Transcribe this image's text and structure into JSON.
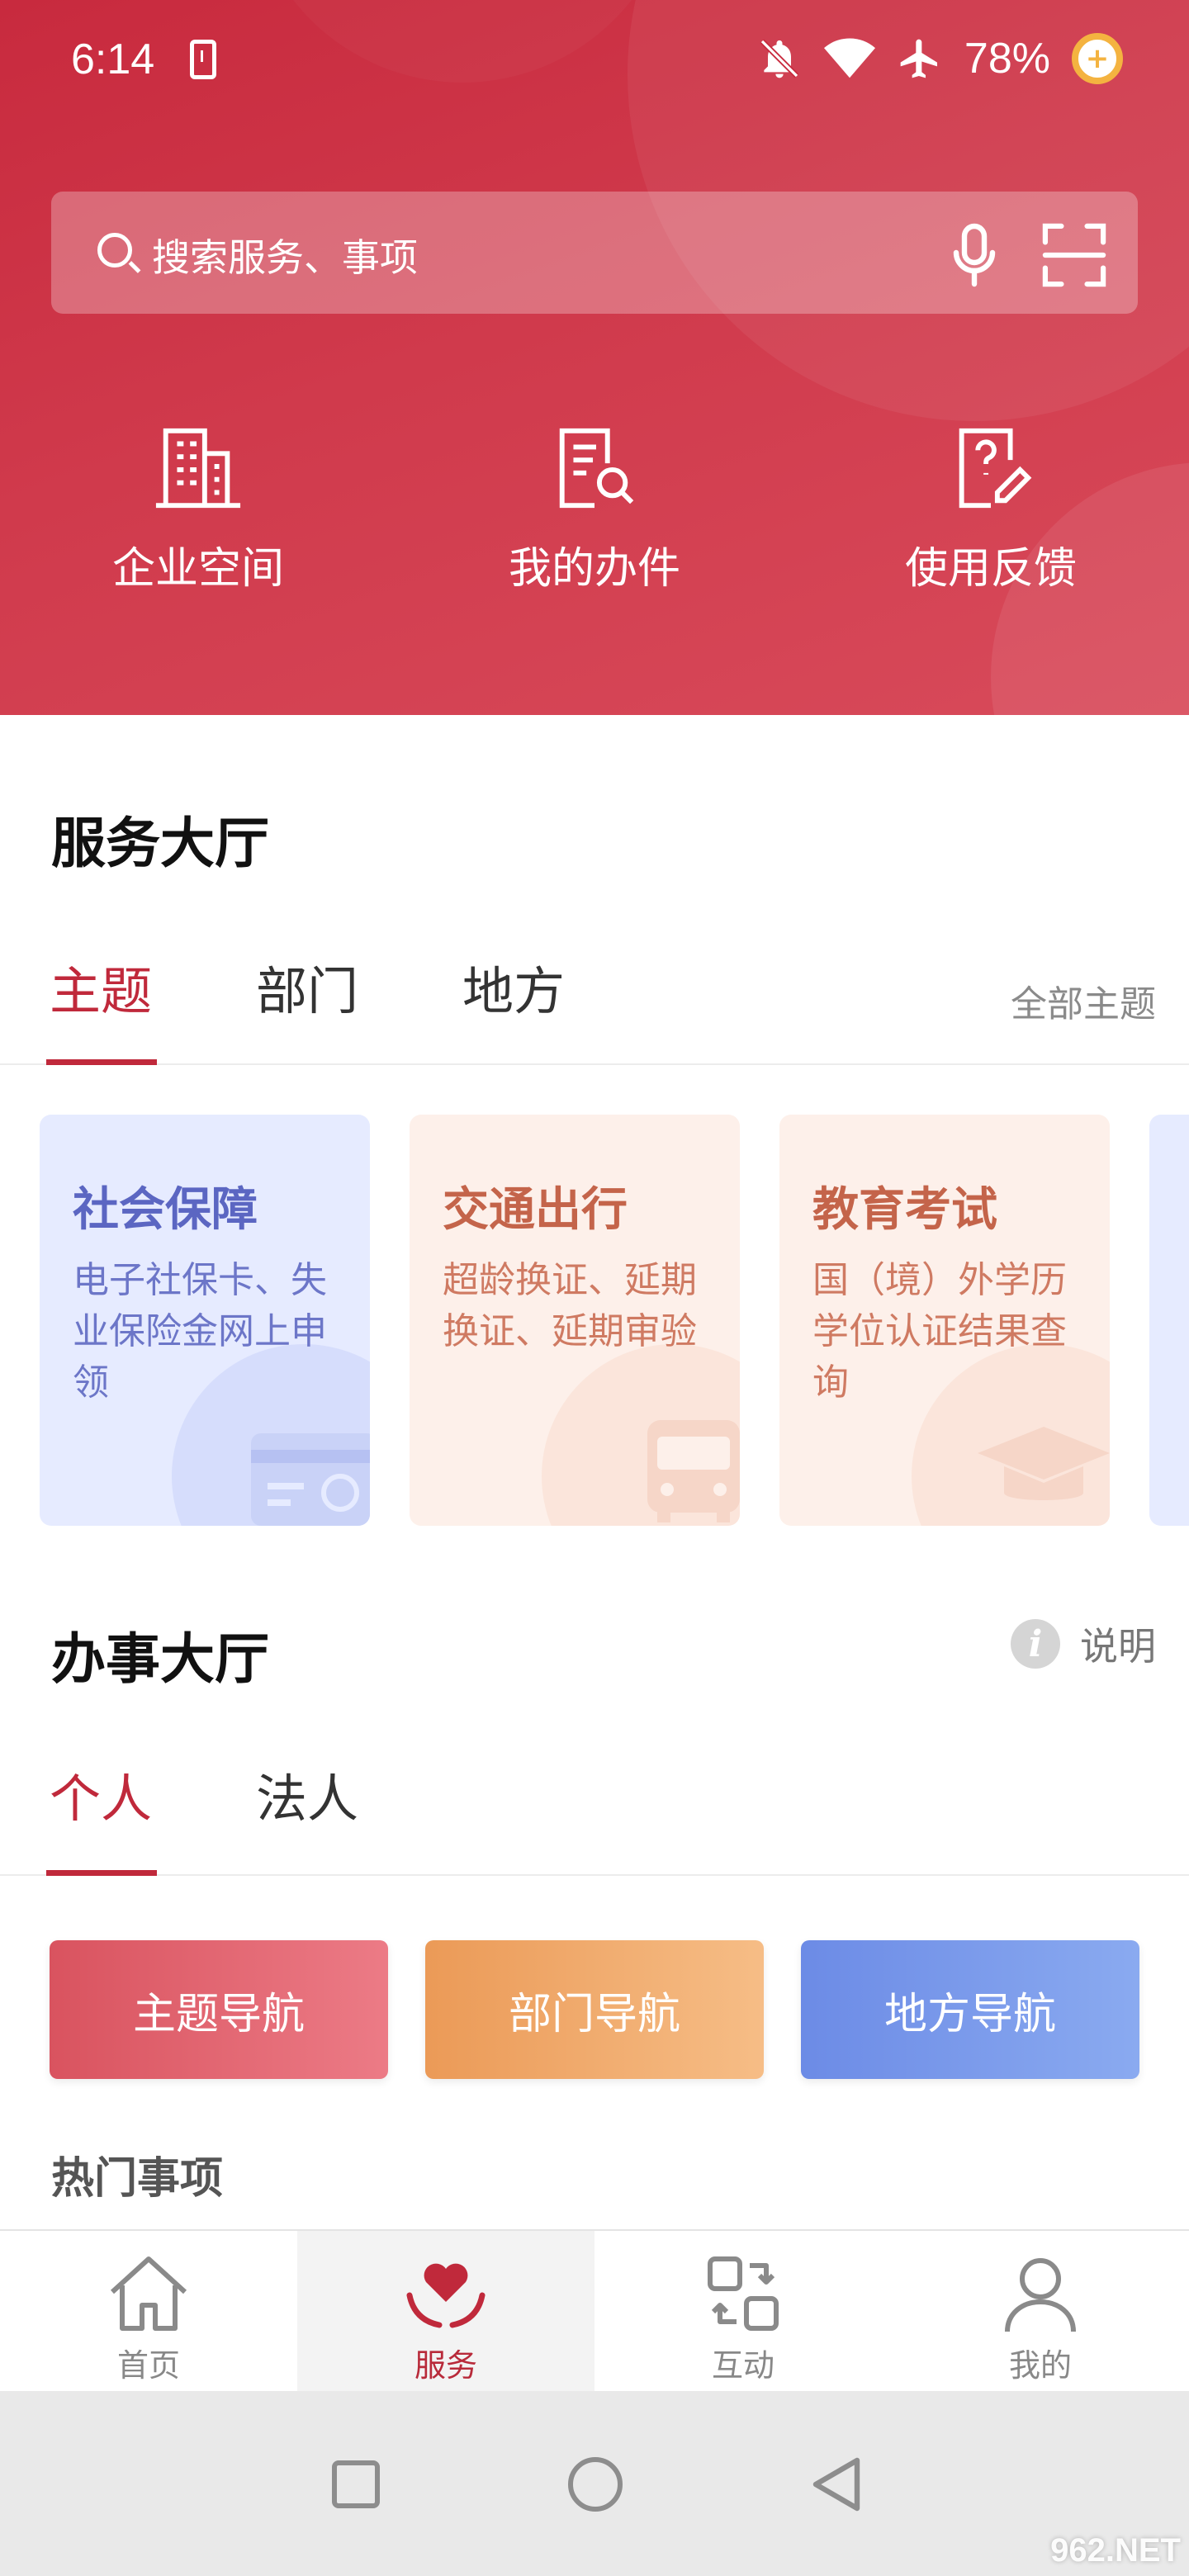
{
  "status": {
    "time": "6:14",
    "battery": "78%"
  },
  "search": {
    "placeholder": "搜索服务、事项"
  },
  "quick_actions": [
    {
      "label": "企业空间",
      "icon": "building-icon"
    },
    {
      "label": "我的办件",
      "icon": "document-search-icon"
    },
    {
      "label": "使用反馈",
      "icon": "feedback-edit-icon"
    }
  ],
  "service_hall": {
    "title": "服务大厅",
    "tabs": [
      "主题",
      "部门",
      "地方"
    ],
    "active_tab": "主题",
    "more": "全部主题",
    "cards": [
      {
        "title": "社会保障",
        "desc": "电子社保卡、失业保险金网上申领",
        "color": "#5b66c2",
        "bg": "#e6ebff"
      },
      {
        "title": "交通出行",
        "desc": "超龄换证、延期换证、延期审验",
        "color": "#c4644a",
        "bg": "#fdf0ea"
      },
      {
        "title": "教育考试",
        "desc": "国（境）外学历学位认证结果查询",
        "color": "#c4644a",
        "bg": "#fdf0ea"
      }
    ]
  },
  "affairs_hall": {
    "title": "办事大厅",
    "help": "说明",
    "tabs": [
      "个人",
      "法人"
    ],
    "active_tab": "个人",
    "nav_buttons": [
      {
        "label": "主题导航",
        "color_from": "#d9535f",
        "color_to": "#ec7b86"
      },
      {
        "label": "部门导航",
        "color_from": "#eb9a57",
        "color_to": "#f6bd86"
      },
      {
        "label": "地方导航",
        "color_from": "#6c8be6",
        "color_to": "#8aaaf0"
      }
    ],
    "hot_items_title": "热门事项"
  },
  "bottom_nav": {
    "items": [
      "首页",
      "服务",
      "互动",
      "我的"
    ],
    "active": "服务"
  },
  "watermark": "962.NET"
}
